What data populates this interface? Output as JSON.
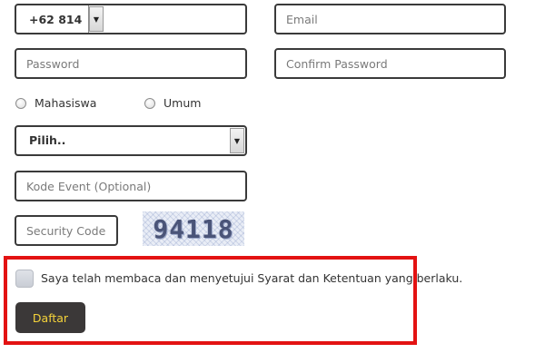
{
  "phone": {
    "country_code": "+62 814",
    "number_value": ""
  },
  "email": {
    "placeholder": "Email"
  },
  "password": {
    "placeholder": "Password"
  },
  "confirm_password": {
    "placeholder": "Confirm Password"
  },
  "user_type": {
    "options": [
      "Mahasiswa",
      "Umum"
    ],
    "selected": null
  },
  "category": {
    "selected_label": "Pilih.."
  },
  "event_code": {
    "placeholder": "Kode Event (Optional)"
  },
  "security_code": {
    "placeholder": "Security Code"
  },
  "captcha": {
    "text": "94118"
  },
  "terms": {
    "label": "Saya telah membaca dan menyetujui Syarat dan Ketentuan yang berlaku.",
    "checked": false
  },
  "submit": {
    "label": "Daftar"
  },
  "colors": {
    "highlight": "#e31212",
    "button_bg": "#3b3838",
    "button_text": "#f5d33a"
  },
  "icons": {
    "dropdown": "chevron-down-icon",
    "radio": "radio-icon",
    "checkbox": "checkbox-icon"
  }
}
